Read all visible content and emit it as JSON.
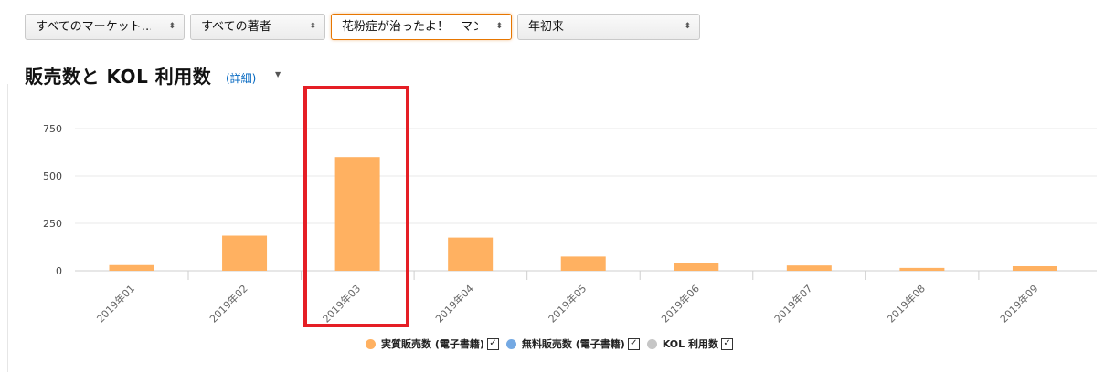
{
  "filters": [
    {
      "label": "すべてのマーケット…",
      "active": false
    },
    {
      "label": "すべての著者",
      "active": false
    },
    {
      "label": "花粉症が治ったよ！　マン…",
      "active": true
    },
    {
      "label": "年初来",
      "active": false
    }
  ],
  "section": {
    "title": "販売数と KOL 利用数",
    "detail_link": "(詳細)"
  },
  "legend": [
    {
      "label": "実質販売数 (電子書籍)",
      "color": "#FFB161",
      "checked": "✓"
    },
    {
      "label": "無料販売数 (電子書籍)",
      "color": "#74A9E3",
      "checked": "✓"
    },
    {
      "label": "KOL 利用数",
      "color": "#C6C6C6",
      "checked": "✓"
    }
  ],
  "colors": {
    "bar": "#FFB161",
    "highlight": "#E51E25",
    "grid": "#E6E6E6",
    "link": "#0066C0"
  },
  "chart_data": {
    "type": "bar",
    "categories": [
      "2019年01",
      "2019年02",
      "2019年03",
      "2019年04",
      "2019年05",
      "2019年06",
      "2019年07",
      "2019年08",
      "2019年09"
    ],
    "series": [
      {
        "name": "実質販売数 (電子書籍)",
        "values": [
          30,
          185,
          600,
          175,
          75,
          42,
          28,
          15,
          24
        ]
      }
    ],
    "yticks": [
      0,
      250,
      500,
      750
    ],
    "ylim": [
      0,
      750
    ],
    "grid": true,
    "legend_position": "bottom",
    "highlighted_category": "2019年03"
  }
}
